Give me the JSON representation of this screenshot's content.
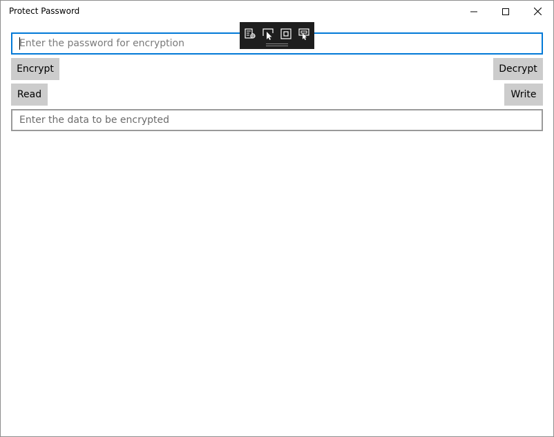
{
  "window": {
    "title": "Protect Password"
  },
  "caption": {
    "minimize_icon": "minimize-icon",
    "maximize_icon": "maximize-icon",
    "close_icon": "close-icon"
  },
  "password": {
    "value": "",
    "placeholder": "Enter the password for encryption"
  },
  "buttons": {
    "encrypt": "Encrypt",
    "decrypt": "Decrypt",
    "read": "Read",
    "write": "Write"
  },
  "data_field": {
    "value": "",
    "placeholder": "Enter the data to be encrypted"
  },
  "debug_toolbar": {
    "icons": [
      "live-visual-tree-icon",
      "select-element-icon",
      "display-layout-adorners-icon",
      "track-focused-element-icon"
    ]
  },
  "colors": {
    "accent": "#0078d7",
    "button_bg": "#cccccc",
    "toolbar_bg": "#1e1e1e"
  }
}
